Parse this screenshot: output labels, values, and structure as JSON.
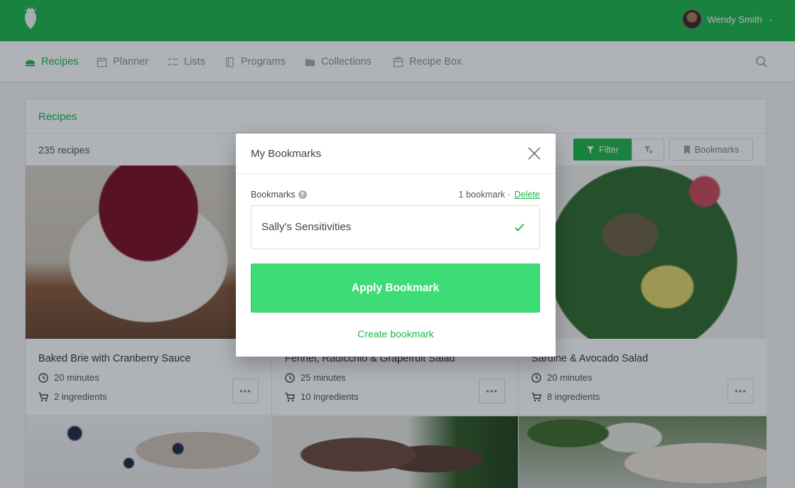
{
  "user": {
    "name": "Wendy Smith"
  },
  "nav": {
    "items": [
      {
        "label": "Recipes",
        "icon": "recipes-icon",
        "active": true
      },
      {
        "label": "Planner",
        "icon": "calendar-icon"
      },
      {
        "label": "Lists",
        "icon": "list-icon"
      },
      {
        "label": "Programs",
        "icon": "book-icon"
      },
      {
        "label": "Collections",
        "icon": "folder-icon"
      },
      {
        "label": "Recipe Box",
        "icon": "box-icon"
      }
    ]
  },
  "panel": {
    "title": "Recipes",
    "count": "235 recipes",
    "filter_label": "Filter",
    "bookmarks_label": "Bookmarks"
  },
  "recipes": [
    {
      "title": "Baked Brie with Cranberry Sauce",
      "time": "20 minutes",
      "ingredients": "2 ingredients"
    },
    {
      "title": "Fennel, Radicchio & Grapefruit Salad",
      "time": "25 minutes",
      "ingredients": "10 ingredients"
    },
    {
      "title": "Sardine & Avocado Salad",
      "time": "20 minutes",
      "ingredients": "8 ingredients"
    }
  ],
  "modal": {
    "title": "My Bookmarks",
    "field_label": "Bookmarks",
    "count_text": "1 bookmark ·",
    "delete_label": "Delete",
    "selected": "Sally's Sensitivities",
    "apply_label": "Apply Bookmark",
    "create_label": "Create bookmark"
  },
  "colors": {
    "brand": "#1cb64a",
    "apply": "#3ddc76"
  }
}
